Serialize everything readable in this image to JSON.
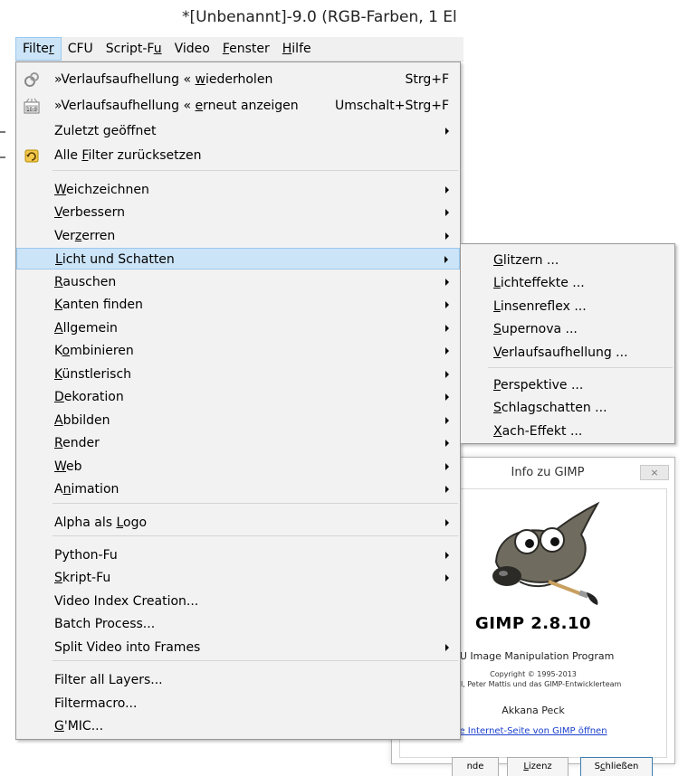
{
  "window": {
    "title": "*[Unbenannt]-9.0 (RGB-Farben, 1 El"
  },
  "menubar": [
    {
      "pre": "Filte",
      "ul": "r",
      "post": "",
      "active": true
    },
    {
      "pre": "CFU",
      "ul": "",
      "post": "",
      "active": false
    },
    {
      "pre": "Script-F",
      "ul": "u",
      "post": "",
      "active": false
    },
    {
      "pre": "Video",
      "ul": "",
      "post": "",
      "active": false
    },
    {
      "pre": "",
      "ul": "F",
      "post": "enster",
      "active": false
    },
    {
      "pre": "",
      "ul": "H",
      "post": "ilfe",
      "active": false
    }
  ],
  "filter_menu": {
    "items": [
      {
        "pre": "»Verlaufsaufhellung « ",
        "ul": "w",
        "post": "iederholen",
        "shortcut": "Strg+F",
        "submenu": false,
        "icon": "repeat-filter-icon"
      },
      {
        "pre": "»Verlaufsaufhellung « ",
        "ul": "e",
        "post": "rneut anzeigen",
        "shortcut": "Umschalt+Strg+F",
        "submenu": false,
        "icon": "reshow-filter-icon"
      },
      {
        "pre": "Zuletzt geöffnet",
        "ul": "",
        "post": "",
        "shortcut": "",
        "submenu": true,
        "icon": ""
      },
      {
        "pre": "Alle ",
        "ul": "F",
        "post": "ilter zurücksetzen",
        "shortcut": "",
        "submenu": false,
        "icon": "reset-filters-icon"
      },
      {
        "pre": "",
        "ul": "W",
        "post": "eichzeichnen",
        "shortcut": "",
        "submenu": true,
        "icon": ""
      },
      {
        "pre": "",
        "ul": "V",
        "post": "erbessern",
        "shortcut": "",
        "submenu": true,
        "icon": ""
      },
      {
        "pre": "Ver",
        "ul": "z",
        "post": "erren",
        "shortcut": "",
        "submenu": true,
        "icon": ""
      },
      {
        "pre": "",
        "ul": "L",
        "post": "icht und Schatten",
        "shortcut": "",
        "submenu": true,
        "icon": "",
        "highlight": true
      },
      {
        "pre": "",
        "ul": "R",
        "post": "auschen",
        "shortcut": "",
        "submenu": true,
        "icon": ""
      },
      {
        "pre": "",
        "ul": "K",
        "post": "anten finden",
        "shortcut": "",
        "submenu": true,
        "icon": ""
      },
      {
        "pre": "",
        "ul": "A",
        "post": "llgemein",
        "shortcut": "",
        "submenu": true,
        "icon": ""
      },
      {
        "pre": "K",
        "ul": "o",
        "post": "mbinieren",
        "shortcut": "",
        "submenu": true,
        "icon": ""
      },
      {
        "pre": "",
        "ul": "K",
        "post": "ünstlerisch",
        "shortcut": "",
        "submenu": true,
        "icon": ""
      },
      {
        "pre": "",
        "ul": "D",
        "post": "ekoration",
        "shortcut": "",
        "submenu": true,
        "icon": ""
      },
      {
        "pre": "",
        "ul": "A",
        "post": "bbilden",
        "shortcut": "",
        "submenu": true,
        "icon": ""
      },
      {
        "pre": "",
        "ul": "R",
        "post": "ender",
        "shortcut": "",
        "submenu": true,
        "icon": ""
      },
      {
        "pre": "",
        "ul": "W",
        "post": "eb",
        "shortcut": "",
        "submenu": true,
        "icon": ""
      },
      {
        "pre": "A",
        "ul": "n",
        "post": "imation",
        "shortcut": "",
        "submenu": true,
        "icon": ""
      },
      {
        "pre": "Alpha als ",
        "ul": "L",
        "post": "ogo",
        "shortcut": "",
        "submenu": true,
        "icon": ""
      },
      {
        "pre": "Python-Fu",
        "ul": "",
        "post": "",
        "shortcut": "",
        "submenu": true,
        "icon": ""
      },
      {
        "pre": "",
        "ul": "S",
        "post": "kript-Fu",
        "shortcut": "",
        "submenu": true,
        "icon": ""
      },
      {
        "pre": "Video Index Creation...",
        "ul": "",
        "post": "",
        "shortcut": "",
        "submenu": false,
        "icon": ""
      },
      {
        "pre": "Batch Process...",
        "ul": "",
        "post": "",
        "shortcut": "",
        "submenu": false,
        "icon": ""
      },
      {
        "pre": "Split Video into Frames",
        "ul": "",
        "post": "",
        "shortcut": "",
        "submenu": true,
        "icon": ""
      },
      {
        "pre": "Filter all Layers...",
        "ul": "",
        "post": "",
        "shortcut": "",
        "submenu": false,
        "icon": ""
      },
      {
        "pre": "Filtermacro...",
        "ul": "",
        "post": "",
        "shortcut": "",
        "submenu": false,
        "icon": ""
      },
      {
        "pre": "",
        "ul": "G",
        "post": "'MIC...",
        "shortcut": "",
        "submenu": false,
        "icon": ""
      }
    ]
  },
  "light_shadow_submenu": {
    "items": [
      {
        "pre": "",
        "ul": "G",
        "post": "litzern ..."
      },
      {
        "pre": "",
        "ul": "L",
        "post": "ichteffekte ..."
      },
      {
        "pre": "",
        "ul": "L",
        "post": "insenreflex ..."
      },
      {
        "pre": "",
        "ul": "S",
        "post": "upernova ..."
      },
      {
        "pre": "",
        "ul": "V",
        "post": "erlaufsaufhellung ..."
      },
      {
        "pre": "",
        "ul": "P",
        "post": "erspektive ..."
      },
      {
        "pre": "",
        "ul": "S",
        "post": "chlagschatten ..."
      },
      {
        "pre": "",
        "ul": "X",
        "post": "ach-Effekt ..."
      }
    ]
  },
  "about_dialog": {
    "title": "Info zu GIMP",
    "close_label": "×",
    "app_name": "GIMP 2.8.10",
    "description": "NU Image Manipulation Program",
    "copyright_line1": "Copyright © 1995-2013",
    "copyright_line2": "nball, Peter Mattis und das GIMP-Entwicklerteam",
    "author": "Akkana Peck",
    "link": "e Internet-Seite von GIMP öffnen",
    "buttons": {
      "credits": "nde",
      "license_pre": "",
      "license_ul": "L",
      "license_post": "izenz",
      "close_pre": "S",
      "close_ul": "c",
      "close_post": "hließen"
    }
  }
}
